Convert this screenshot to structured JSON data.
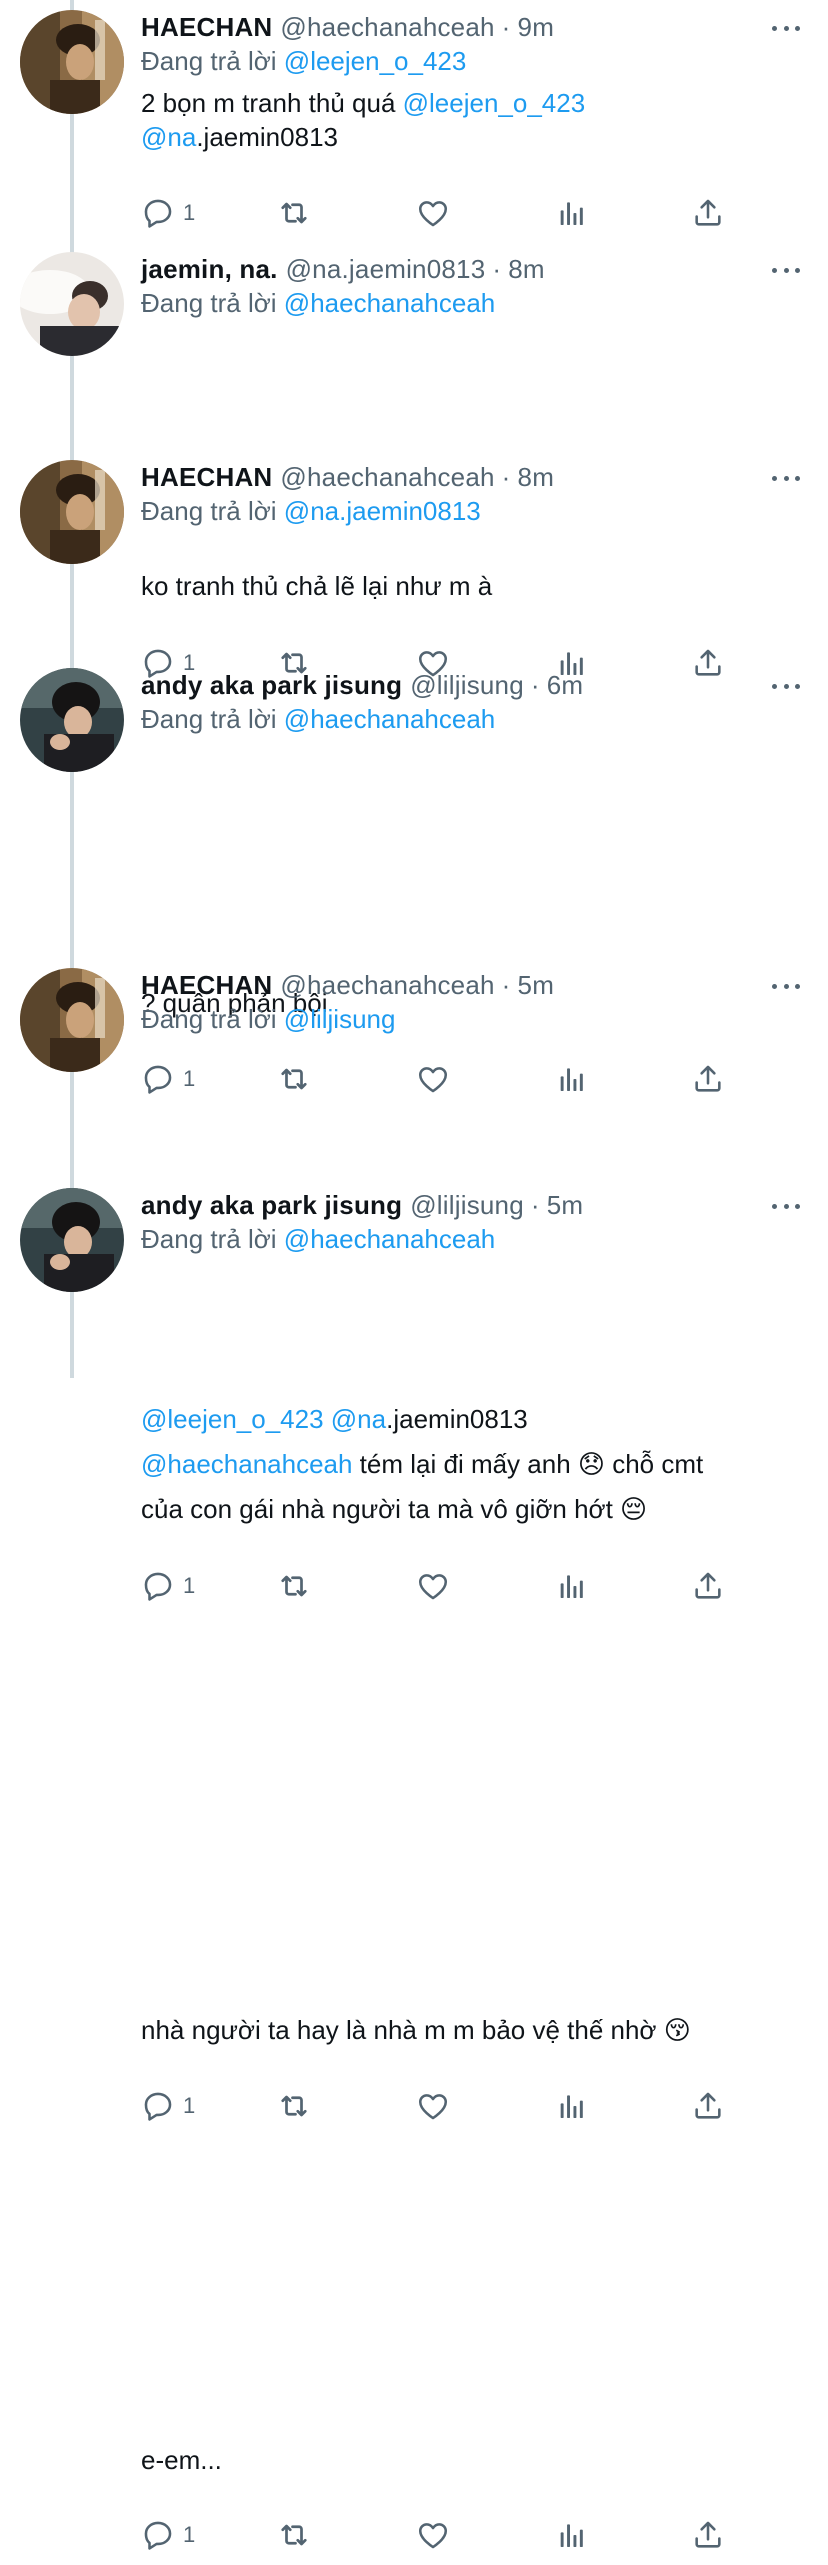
{
  "colors": {
    "accent": "#1d9bf0",
    "muted": "#536471",
    "text": "#0f1419",
    "thread_line": "#cfd9de"
  },
  "replying_prefix": "Đang trả lời",
  "tweets": [
    {
      "name": "HAECHAN",
      "handle": "@haechanahceah",
      "dot": "·",
      "time": "9m",
      "reply_to": "@leejen_o_423",
      "lines": [
        [
          {
            "text": "2 bọn m tranh thủ quá ",
            "mention": false
          },
          {
            "text": "@leejen_o_423",
            "mention": true
          }
        ],
        [
          {
            "text": "@na",
            "mention": true
          },
          {
            "text": ".jaemin0813",
            "mention": false
          }
        ]
      ],
      "reply_count": "1",
      "avatar": "haechan"
    },
    {
      "name": "jaemin, na.",
      "handle": "@na.jaemin0813",
      "dot": "·",
      "time": "8m",
      "reply_to": "@haechanahceah",
      "lines": [
        [
          {
            "text": "ko tranh thủ chả lẽ lại như m à",
            "mention": false
          }
        ]
      ],
      "reply_count": "1",
      "avatar": "jaemin"
    },
    {
      "name": "HAECHAN",
      "handle": "@haechanahceah",
      "dot": "·",
      "time": "8m",
      "reply_to": "@na.jaemin0813",
      "lines": [
        [
          {
            "text": "? quân phản bội",
            "mention": false
          }
        ]
      ],
      "reply_count": "1",
      "avatar": "haechan"
    },
    {
      "name": "andy aka park jisung",
      "handle": "@liljisung",
      "dot": "·",
      "time": "6m",
      "reply_to": "@haechanahceah",
      "lines": [
        [
          {
            "text": "@leejen_o_423",
            "mention": true
          },
          {
            "text": " ",
            "mention": false
          },
          {
            "text": "@na",
            "mention": true
          },
          {
            "text": ".jaemin0813",
            "mention": false
          }
        ],
        [
          {
            "text": "@haechanahceah",
            "mention": true
          },
          {
            "text": " tém lại đi mấy anh 😞  chỗ cmt",
            "mention": false
          }
        ],
        [
          {
            "text": "của con gái nhà người ta mà vô giỡn hớt 😔",
            "mention": false
          }
        ]
      ],
      "reply_count": "1",
      "avatar": "jisung"
    },
    {
      "name": "HAECHAN",
      "handle": "@haechanahceah",
      "dot": "·",
      "time": "5m",
      "reply_to": "@liljisung",
      "lines": [
        [
          {
            "text": "nhà người ta hay là nhà m m bảo vệ thế nhờ 😚",
            "mention": false
          }
        ]
      ],
      "reply_count": "1",
      "avatar": "haechan"
    },
    {
      "name": "andy aka park jisung",
      "handle": "@liljisung",
      "dot": "·",
      "time": "5m",
      "reply_to": "@haechanahceah",
      "lines": [
        [
          {
            "text": "e-em...",
            "mention": false
          }
        ]
      ],
      "reply_count": "1",
      "avatar": "jisung"
    }
  ]
}
